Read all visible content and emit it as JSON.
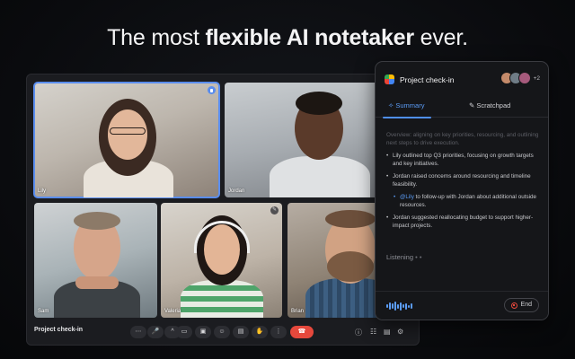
{
  "headline": {
    "prefix": "The most ",
    "bold": "flexible AI notetaker",
    "suffix": " ever."
  },
  "meeting": {
    "title": "Project check-in",
    "participants": [
      "Lily",
      "Jordan",
      "Sam",
      "Valeria",
      "Brian"
    ],
    "controls": [
      "more",
      "mic",
      "chevron",
      "camera",
      "captions",
      "emoji",
      "present",
      "raise-hand",
      "options",
      "end-call"
    ],
    "end_color": "#e5483c"
  },
  "panel": {
    "title": "Project check-in",
    "more_count": "+2",
    "tabs": {
      "summary": "Summary",
      "scratchpad": "Scratchpad"
    },
    "faded_intro": "Overview: aligning on key priorities, resourcing, and outlining next steps to drive execution.",
    "notes": [
      "Lily outlined top Q3 priorities, focusing on growth targets and key initiatives.",
      "Jordan raised concerns around resourcing and timeline feasibility."
    ],
    "action_item": {
      "mention": "@Lily",
      "text": " to follow-up with Jordan about additional outside resources."
    },
    "last_note": "Jordan suggested reallocating budget to support higher-impact projects.",
    "listening": "Listening",
    "end_label": "End",
    "accent": "#5b9cf6"
  }
}
